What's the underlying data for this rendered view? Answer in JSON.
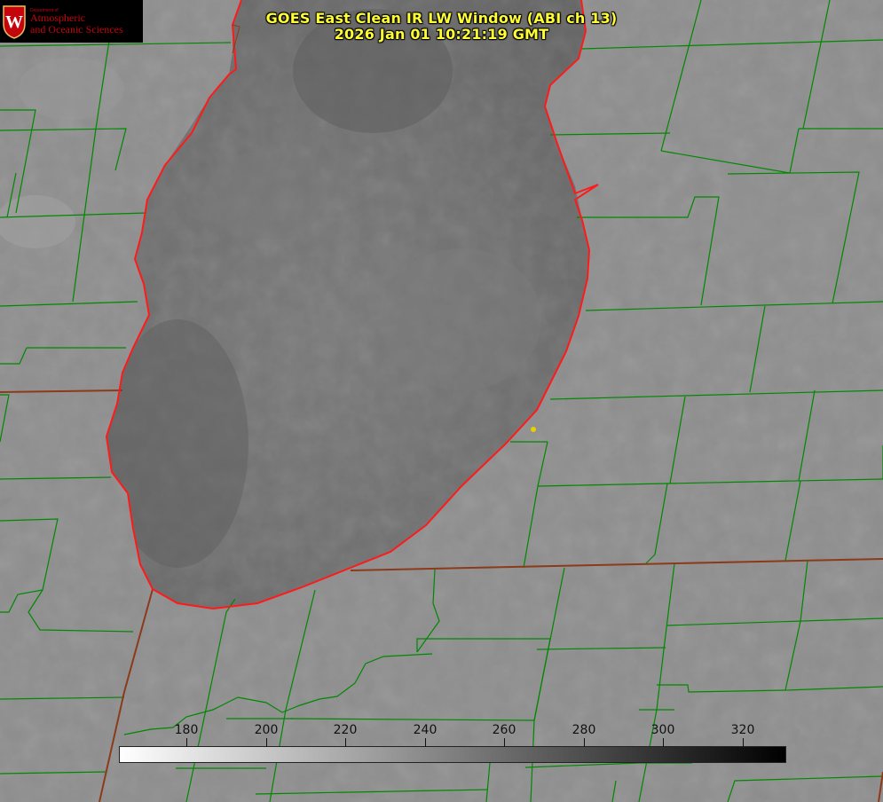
{
  "title": {
    "line1": "GOES East Clean IR LW Window (ABI ch 13)",
    "line2": "2026 Jan 01 10:21:19 GMT"
  },
  "logo": {
    "dept": "Department of",
    "line1": "Atmospheric",
    "line2": "and Oceanic Sciences",
    "crest_letter": "W",
    "color": "#c5050c"
  },
  "colorbar": {
    "ticks": [
      "180",
      "200",
      "220",
      "240",
      "260",
      "280",
      "300",
      "320"
    ],
    "tick_values": [
      180,
      200,
      220,
      240,
      260,
      280,
      300,
      320
    ],
    "range": [
      163,
      331
    ],
    "gradient_from": "#ffffff",
    "gradient_to": "#000000"
  },
  "colors": {
    "land": "#8e8e8e",
    "lake": "#6d6d6d",
    "county_lines": "#008800",
    "state_lines": "#8b3a1a",
    "shoreline": "#ff1a1a",
    "marker": "#e8d000",
    "title_text": "#ffff33"
  }
}
